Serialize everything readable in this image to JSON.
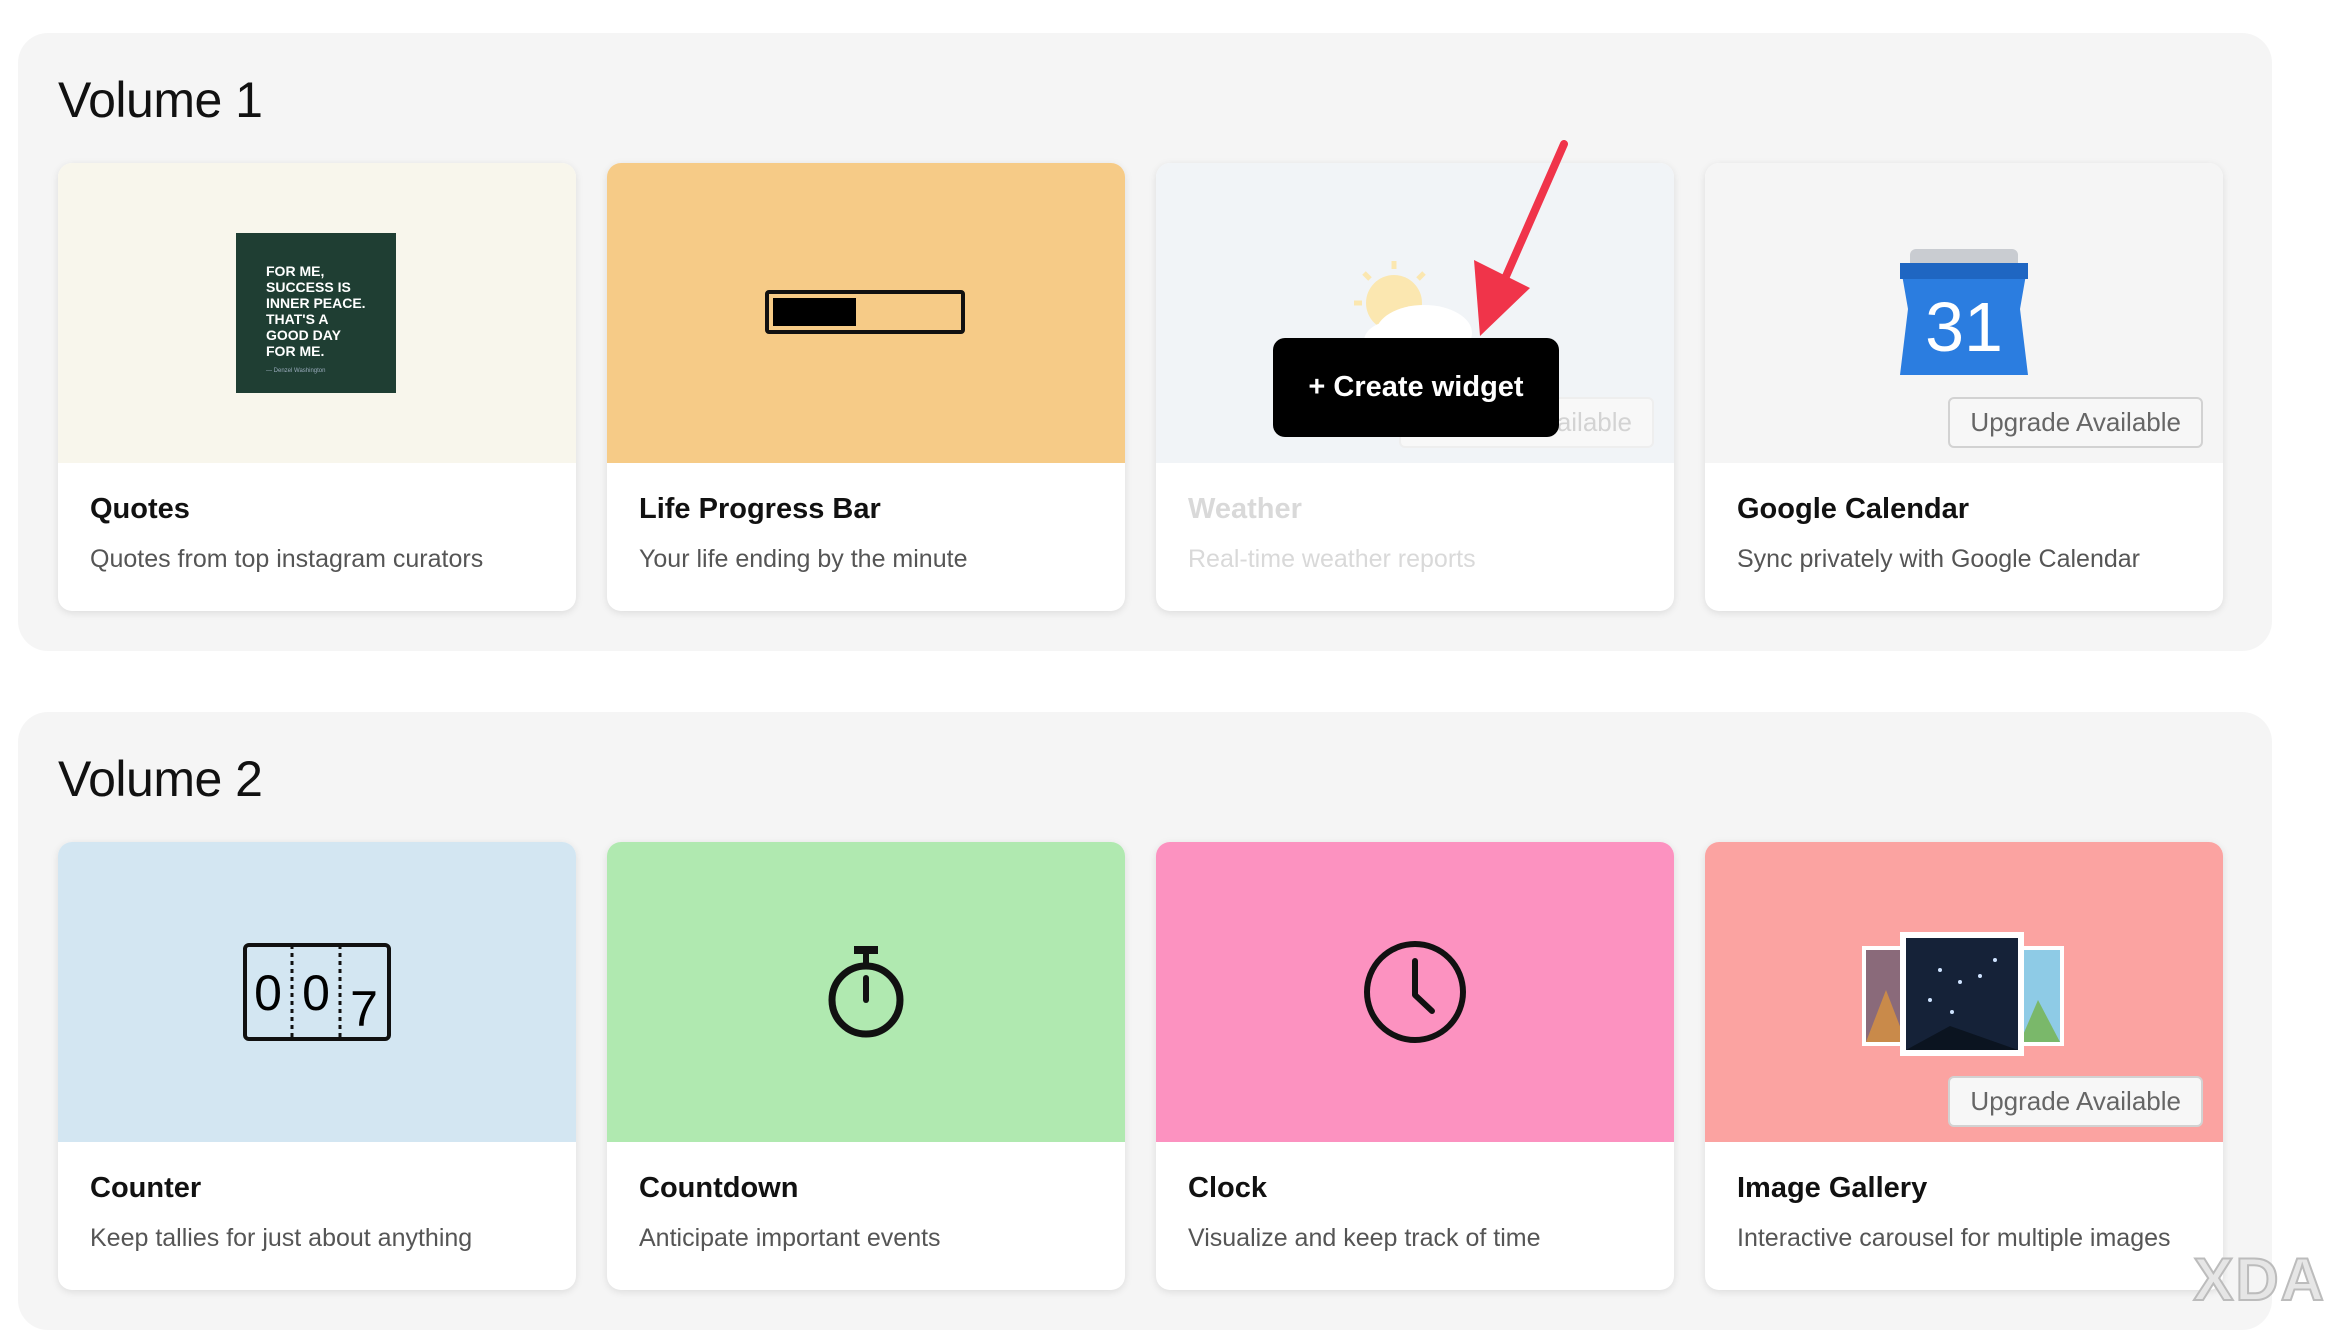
{
  "volumes": [
    {
      "title": "Volume 1",
      "cards": [
        {
          "title": "Quotes",
          "desc": "Quotes from top instagram curators",
          "bg": "#f8f6ec",
          "icon": "quote-image-icon"
        },
        {
          "title": "Life Progress Bar",
          "desc": "Your life ending by the minute",
          "bg": "#f6cb87",
          "icon": "progress-bar-icon",
          "progress_fraction": 0.45
        },
        {
          "title": "Weather",
          "desc": "Real-time weather reports",
          "bg": "#f1f4f7",
          "icon": "sun-cloud-icon",
          "upgrade": "Upgrade Available",
          "state": "disabled"
        },
        {
          "title": "Google Calendar",
          "desc": "Sync privately with Google Calendar",
          "bg": "#f5f5f5",
          "icon": "google-calendar-icon",
          "upgrade": "Upgrade Available"
        }
      ]
    },
    {
      "title": "Volume 2",
      "cards": [
        {
          "title": "Counter",
          "desc": "Keep tallies for just about anything",
          "bg": "#d3e6f2",
          "icon": "counter-icon"
        },
        {
          "title": "Countdown",
          "desc": "Anticipate important events",
          "bg": "#b0e9b0",
          "icon": "stopwatch-icon"
        },
        {
          "title": "Clock",
          "desc": "Visualize and keep track of time",
          "bg": "#fc92c0",
          "icon": "clock-icon"
        },
        {
          "title": "Image Gallery",
          "desc": "Interactive carousel for multiple images",
          "bg": "#fba3a1",
          "icon": "image-gallery-icon",
          "upgrade": "Upgrade Available"
        }
      ]
    }
  ],
  "quote_text": [
    "FOR ME,",
    "SUCCESS IS",
    "INNER PEACE.",
    "THAT'S A",
    "GOOD DAY",
    "FOR ME."
  ],
  "quote_author": "— Denzel Washington",
  "calendar_day": "31",
  "counter_digits": [
    "0",
    "0",
    "7"
  ],
  "create_button": {
    "label": "+ Create widget"
  },
  "colors": {
    "arrow": "#f0344a",
    "create_button_bg": "#000000",
    "section_bg": "#f5f5f5"
  },
  "watermark": "XDA"
}
